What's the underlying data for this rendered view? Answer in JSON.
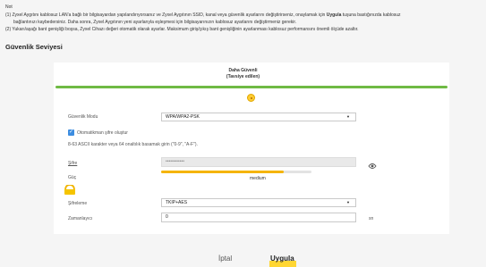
{
  "note": {
    "heading": "Not",
    "line1_a": "(1) Zyxel Aygıtını kablosuz LAN'a bağlı bir bilgisayardan yapılandırıyorsanız ve Zyxel Aygıtının SSID, kanal veya güvenlik ayarlarını değiştirirseniz, onaylamak için ",
    "line1_bold": "Uygula",
    "line1_b": " tuşuna bastığınızda kablosuz",
    "line2": "bağlantınızı kaybedersiniz. Daha sonra, Zyxel Aygıtının yeni ayarlarıyla eşleşmesi için bilgisayarınızın kablosuz ayarlarını değiştirmeniz gerekir.",
    "line3": "(2) Yukarı/aşağı bant genişliği boşsa, Zyxel Cihazı değeri otomatik olarak ayarlar. Maksimum giriş/çıkış bant genişliğinin ayarlanması kablosuz performansını önemli ölçüde azaltır."
  },
  "section_title": "Güvenlik Seviyesi",
  "level": {
    "label": "Daha Güvenli",
    "sublabel": "(Tavsiye edilen)",
    "value_fraction": 0.5
  },
  "form": {
    "security_mode_label": "Güvenlik Modu",
    "security_mode_value": "WPA/WPA2-PSK",
    "auto_password_label": "Otomatikman şifre oluştur",
    "auto_password_checked": true,
    "hint": "8-63 ASCII karakter veya 64 onaltılık basamak girin (\"0-9\", \"A-F\").",
    "password_label": "Şifre",
    "password_value": "••••••••••••",
    "strength_label": "Güç",
    "strength_text": "medium",
    "encryption_label": "Şifreleme",
    "encryption_value": "TKIP+AES",
    "timer_label": "Zamanlayıcı",
    "timer_value": "0",
    "timer_unit": "sn"
  },
  "buttons": {
    "cancel": "İptal",
    "apply": "Uygula"
  },
  "colors": {
    "accent_green": "#6fba44",
    "accent_yellow": "#ffcc33",
    "checkbox_blue": "#3d8de0"
  },
  "icons": {
    "eye": "eye-icon",
    "lock": "lock-icon",
    "dropdown": "chevron-down-icon"
  }
}
